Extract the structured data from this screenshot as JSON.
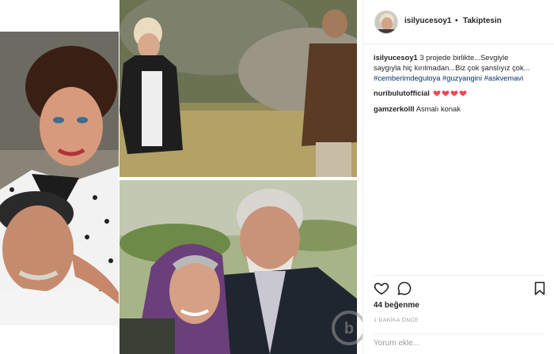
{
  "post": {
    "username": "isilyucesoy1",
    "separator": "•",
    "follow_status": "Takiptesin",
    "caption": {
      "username": "isilyucesoy1",
      "text_line1": "3 projede birlikte...Sevgiyle",
      "text_line2": "saygıyla hiç kırılmadan...Biz çok şanslıyız çok...",
      "hashtags": [
        "#cemberimdeguloya",
        "#guzyangini",
        "#askvemavi"
      ]
    },
    "comments": [
      {
        "username": "nuribulutofficial",
        "text": "",
        "heart_count": 4
      },
      {
        "username": "gamzerkolll",
        "text": "Asmalı konak"
      }
    ],
    "likes": "44 beğenme",
    "time": "1 DAKİKA ÖNCE",
    "add_comment": {
      "placeholder": "Yorum ekle..."
    }
  },
  "icons": {
    "like": "heart-outline-icon",
    "comment": "speech-bubble-icon",
    "save": "bookmark-icon",
    "heart": "red-heart-icon",
    "watermark": "site-watermark-logo"
  },
  "colors": {
    "heart_red": "#ed4956",
    "hashtag_blue": "#003569",
    "text": "#262626",
    "meta_gray": "#999999",
    "border": "#efefef"
  }
}
